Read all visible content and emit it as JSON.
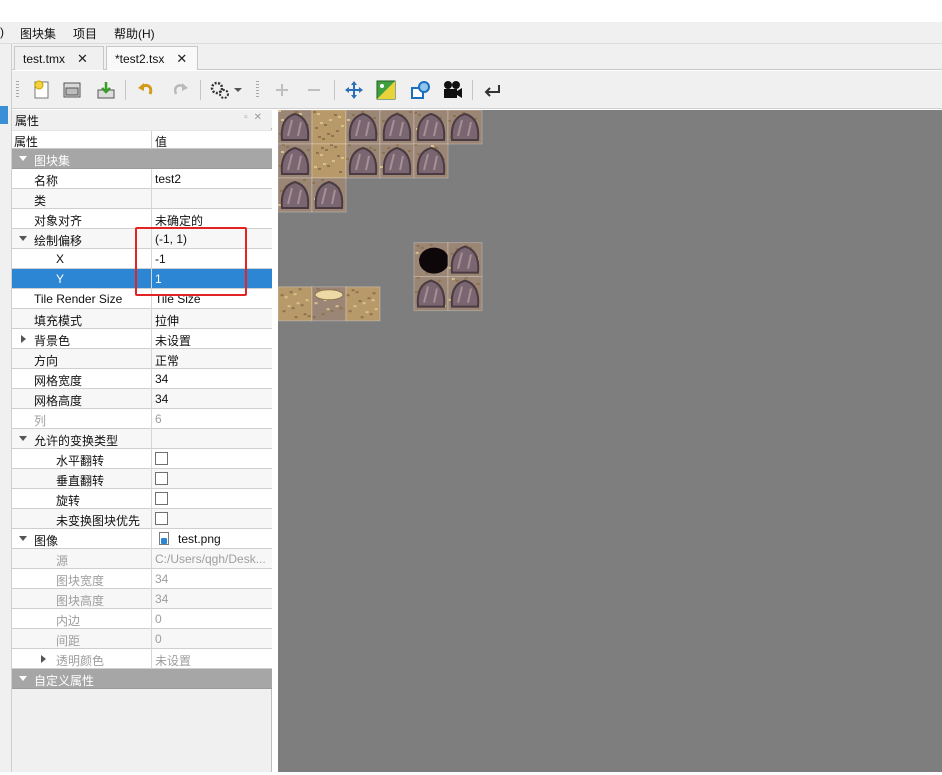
{
  "menubar": {
    "edge_fragment": ")",
    "items": [
      "图块集",
      "项目",
      "帮助(H)"
    ]
  },
  "tabs": [
    {
      "label": "test.tmx",
      "close": "✕"
    },
    {
      "label": "*test2.tsx",
      "close": "✕"
    }
  ],
  "toolbar": {
    "icons": [
      "new-tileset-icon",
      "open-icon",
      "save-icon",
      "undo-icon",
      "redo-icon",
      "settings-icon",
      "dropdown-arrow-icon",
      "add-tile-icon",
      "remove-tile-icon",
      "move-icon",
      "image-icon",
      "shapes-icon",
      "camera-icon",
      "return-icon"
    ]
  },
  "properties_panel": {
    "title": "属性",
    "col_name": "属性",
    "col_value": "值",
    "rows": [
      {
        "type": "group",
        "name": "图块集",
        "expanded": true
      },
      {
        "type": "prop",
        "name": "名称",
        "value": "test2"
      },
      {
        "type": "prop",
        "name": "类",
        "value": ""
      },
      {
        "type": "prop",
        "name": "对象对齐",
        "value": "未确定的"
      },
      {
        "type": "expandable",
        "name": "绘制偏移",
        "value": "(-1, 1)",
        "expanded": true
      },
      {
        "type": "sub",
        "name": "X",
        "value": "-1"
      },
      {
        "type": "sub",
        "name": "Y",
        "value": "1",
        "selected": true
      },
      {
        "type": "prop",
        "name": "Tile Render Size",
        "value": "Tile Size"
      },
      {
        "type": "prop",
        "name": "填充模式",
        "value": "拉伸"
      },
      {
        "type": "collapsed",
        "name": "背景色",
        "value": "未设置"
      },
      {
        "type": "prop",
        "name": "方向",
        "value": "正常"
      },
      {
        "type": "prop",
        "name": "网格宽度",
        "value": "34"
      },
      {
        "type": "prop",
        "name": "网格高度",
        "value": "34"
      },
      {
        "type": "prop",
        "name": "列",
        "value": "6",
        "disabled": true
      },
      {
        "type": "expandable",
        "name": "允许的变换类型",
        "value": "",
        "expanded": true
      },
      {
        "type": "check",
        "name": "水平翻转",
        "checked": false
      },
      {
        "type": "check",
        "name": "垂直翻转",
        "checked": false
      },
      {
        "type": "check",
        "name": "旋转",
        "checked": false
      },
      {
        "type": "check",
        "name": "未变换图块优先",
        "checked": false
      },
      {
        "type": "expandable",
        "name": "图像",
        "value": "test.png",
        "expanded": true,
        "file": true
      },
      {
        "type": "sub",
        "name": "源",
        "value": "C:/Users/qgh/Desk...",
        "disabled": true
      },
      {
        "type": "sub",
        "name": "图块宽度",
        "value": "34",
        "disabled": true
      },
      {
        "type": "sub",
        "name": "图块高度",
        "value": "34",
        "disabled": true
      },
      {
        "type": "sub",
        "name": "内边",
        "value": "0",
        "disabled": true
      },
      {
        "type": "sub",
        "name": "间距",
        "value": "0",
        "disabled": true
      },
      {
        "type": "subcollapsed",
        "name": "透明颜色",
        "value": "未设置",
        "disabled": true
      },
      {
        "type": "group",
        "name": "自定义属性",
        "expanded": true
      }
    ]
  },
  "colors": {
    "selection": "#2d86d3",
    "group_header": "#a6a6a6",
    "canvas_bg": "#7e7e7e",
    "annotation": "#e32424"
  }
}
